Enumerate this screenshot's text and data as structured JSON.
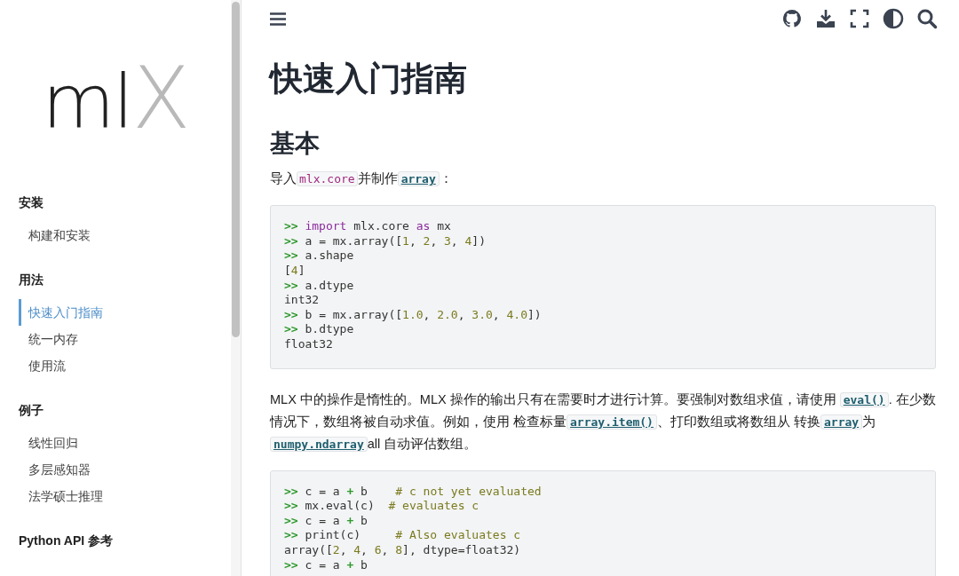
{
  "logo": {
    "dark": "ml",
    "light": "X"
  },
  "sidebar": {
    "sections": [
      {
        "title": "安装",
        "items": [
          {
            "label": "构建和安装",
            "selected": false
          }
        ]
      },
      {
        "title": "用法",
        "items": [
          {
            "label": "快速入门指南",
            "selected": true
          },
          {
            "label": "统一内存",
            "selected": false
          },
          {
            "label": "使用流",
            "selected": false
          }
        ]
      },
      {
        "title": "例子",
        "items": [
          {
            "label": "线性回归",
            "selected": false
          },
          {
            "label": "多层感知器",
            "selected": false
          },
          {
            "label": "法学硕士推理",
            "selected": false
          }
        ]
      },
      {
        "title": "Python API 参考"
      }
    ]
  },
  "toolbar": {
    "icons": [
      {
        "kind": "github"
      },
      {
        "kind": "download"
      },
      {
        "kind": "fullscreen"
      },
      {
        "kind": "theme"
      },
      {
        "kind": "search"
      }
    ]
  },
  "content": {
    "title": "快速入门指南",
    "section": "基本",
    "blocks": [
      {
        "kind": "para",
        "segments": [
          {
            "kind": "text",
            "text": "导入"
          },
          {
            "kind": "code",
            "text": "mlx.core"
          },
          {
            "kind": "text",
            "text": "并制作"
          },
          {
            "kind": "link",
            "text": "array"
          },
          {
            "kind": "text",
            "text": "："
          }
        ]
      },
      {
        "kind": "code",
        "lines": [
          [
            {
              "kind": "prompt",
              "text": ">>"
            },
            {
              "kind": "keyword",
              "text": "import"
            },
            {
              "kind": "plain",
              "text": " mlx.core "
            },
            {
              "kind": "keyword",
              "text": "as"
            },
            {
              "kind": "plain",
              "text": " mx"
            }
          ],
          [
            {
              "kind": "prompt",
              "text": ">>"
            },
            {
              "kind": "plain",
              "text": " a = mx.array(["
            },
            {
              "kind": "number",
              "text": "1"
            },
            {
              "kind": "plain",
              "text": ", "
            },
            {
              "kind": "number",
              "text": "2"
            },
            {
              "kind": "plain",
              "text": ", "
            },
            {
              "kind": "number",
              "text": "3"
            },
            {
              "kind": "plain",
              "text": ", "
            },
            {
              "kind": "number",
              "text": "4"
            },
            {
              "kind": "plain",
              "text": "])"
            }
          ],
          [
            {
              "kind": "prompt",
              "text": ">>"
            },
            {
              "kind": "plain",
              "text": " a.shape"
            }
          ],
          [
            {
              "kind": "plain",
              "text": "["
            },
            {
              "kind": "number",
              "text": "4"
            },
            {
              "kind": "plain",
              "text": "]"
            }
          ],
          [
            {
              "kind": "prompt",
              "text": ">>"
            },
            {
              "kind": "plain",
              "text": " a.dtype"
            }
          ],
          [
            {
              "kind": "plain",
              "text": "int32"
            }
          ],
          [
            {
              "kind": "prompt",
              "text": ">>"
            },
            {
              "kind": "plain",
              "text": " b = mx.array(["
            },
            {
              "kind": "number",
              "text": "1.0"
            },
            {
              "kind": "plain",
              "text": ", "
            },
            {
              "kind": "number",
              "text": "2.0"
            },
            {
              "kind": "plain",
              "text": ", "
            },
            {
              "kind": "number",
              "text": "3.0"
            },
            {
              "kind": "plain",
              "text": ", "
            },
            {
              "kind": "number",
              "text": "4.0"
            },
            {
              "kind": "plain",
              "text": "])"
            }
          ],
          [
            {
              "kind": "prompt",
              "text": ">>"
            },
            {
              "kind": "plain",
              "text": " b.dtype"
            }
          ],
          [
            {
              "kind": "plain",
              "text": "float32"
            }
          ]
        ]
      },
      {
        "kind": "para",
        "segments": [
          {
            "kind": "text",
            "text": "MLX 中的操作是惰性的。MLX 操作的输出只有在需要时才进行计算。要强制对数组求值，请使用 "
          },
          {
            "kind": "link",
            "text": "eval()"
          },
          {
            "kind": "text",
            "text": ". 在少数情况下，数组将被自动求值。例如，使用 检查标量"
          },
          {
            "kind": "link",
            "text": "array.item()"
          },
          {
            "kind": "text",
            "text": "、打印数组或将数组从 转换"
          },
          {
            "kind": "link",
            "text": "array"
          },
          {
            "kind": "text",
            "text": "为"
          },
          {
            "kind": "link",
            "text": "numpy.ndarray"
          },
          {
            "kind": "text",
            "text": "all 自动评估数组。"
          }
        ]
      },
      {
        "kind": "code",
        "lines": [
          [
            {
              "kind": "prompt",
              "text": ">>"
            },
            {
              "kind": "plain",
              "text": " c = a "
            },
            {
              "kind": "op",
              "text": "+"
            },
            {
              "kind": "plain",
              "text": " b    "
            },
            {
              "kind": "comment",
              "text": "# c not yet evaluated"
            }
          ],
          [
            {
              "kind": "prompt",
              "text": ">>"
            },
            {
              "kind": "plain",
              "text": " mx.eval(c)  "
            },
            {
              "kind": "comment",
              "text": "# evaluates c"
            }
          ],
          [
            {
              "kind": "prompt",
              "text": ">>"
            },
            {
              "kind": "plain",
              "text": " c = a "
            },
            {
              "kind": "op",
              "text": "+"
            },
            {
              "kind": "plain",
              "text": " b"
            }
          ],
          [
            {
              "kind": "prompt",
              "text": ">>"
            },
            {
              "kind": "plain",
              "text": " print(c)     "
            },
            {
              "kind": "comment",
              "text": "# Also evaluates c"
            }
          ],
          [
            {
              "kind": "plain",
              "text": "array(["
            },
            {
              "kind": "number",
              "text": "2"
            },
            {
              "kind": "plain",
              "text": ", "
            },
            {
              "kind": "number",
              "text": "4"
            },
            {
              "kind": "plain",
              "text": ", "
            },
            {
              "kind": "number",
              "text": "6"
            },
            {
              "kind": "plain",
              "text": ", "
            },
            {
              "kind": "number",
              "text": "8"
            },
            {
              "kind": "plain",
              "text": "], dtype=float32)"
            }
          ],
          [
            {
              "kind": "prompt",
              "text": ">>"
            },
            {
              "kind": "plain",
              "text": " c = a "
            },
            {
              "kind": "op",
              "text": "+"
            },
            {
              "kind": "plain",
              "text": " b"
            }
          ]
        ]
      }
    ]
  }
}
